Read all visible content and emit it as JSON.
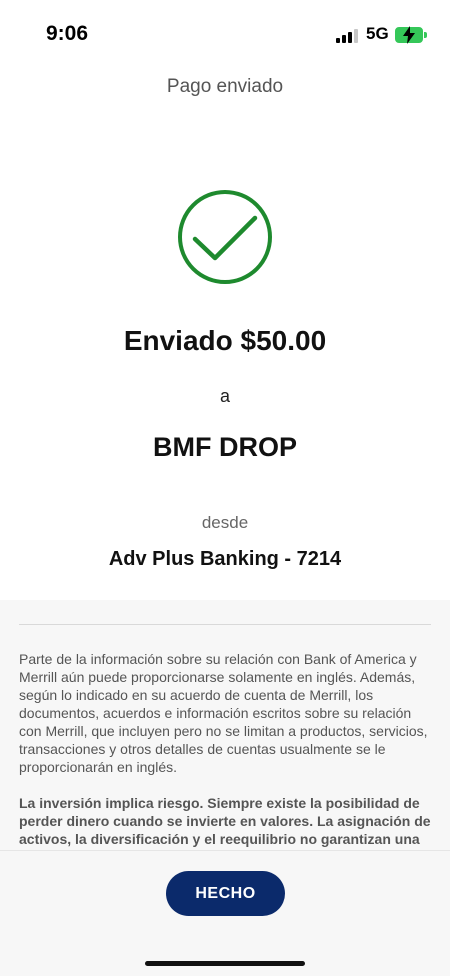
{
  "status_bar": {
    "time": "9:06",
    "network": "5G"
  },
  "header": {
    "title": "Pago enviado"
  },
  "confirmation": {
    "sent_amount": "Enviado $50.00",
    "to_label": "a",
    "recipient": "BMF DROP",
    "from_label": "desde",
    "account": "Adv Plus Banking - 7214"
  },
  "disclosure": {
    "paragraph_1": "Parte de la información sobre su relación con Bank of America y Merrill aún puede proporcionarse solamente en inglés. Además, según lo indicado en su acuerdo de cuenta de Merrill, los documentos, acuerdos e información escritos sobre su relación con Merrill, que incluyen pero no se limitan a productos, servicios, transacciones y otros detalles de cuentas usualmente se le proporcionarán en inglés.",
    "paragraph_2": "La inversión implica riesgo. Siempre existe la posibilidad de perder dinero cuando se invierte en valores. La asignación de activos, la diversificación y el reequilibrio no garantizan una ganancia ni protegen contra pérdidas"
  },
  "actions": {
    "done_label": "HECHO"
  },
  "colors": {
    "success_green": "#1e8a2e",
    "button_navy": "#0b2a6b",
    "battery_green": "#35c759"
  },
  "icons": {
    "success": "check-circle-icon",
    "signal": "signal-bars-icon",
    "battery": "battery-charging-icon"
  }
}
